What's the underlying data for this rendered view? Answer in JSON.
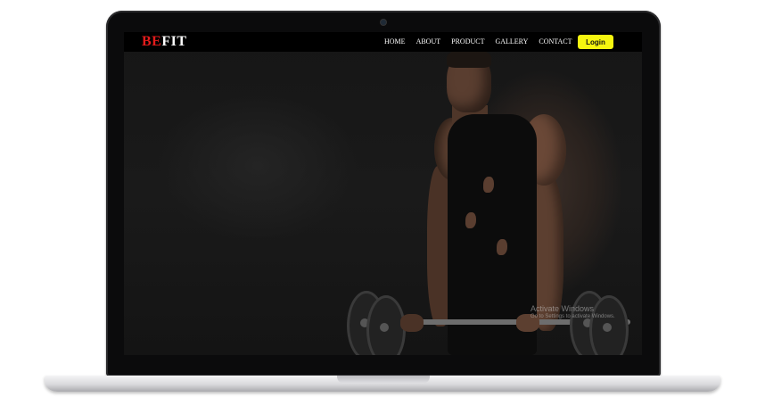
{
  "brand": {
    "part1": "BE",
    "part2": "FIT",
    "color_part1": "#e31b1b",
    "color_part2": "#ffffff"
  },
  "nav": {
    "links": [
      {
        "label": "HOME"
      },
      {
        "label": "ABOUT"
      },
      {
        "label": "PRODUCT"
      },
      {
        "label": "GALLERY"
      },
      {
        "label": "CONTACT"
      }
    ],
    "login_label": "Login",
    "login_color": "#f5f50f"
  },
  "watermark": {
    "title": "Activate Windows",
    "subtitle": "Go to Settings to activate Windows."
  },
  "colors": {
    "navbar_bg": "#000000",
    "hero_bg": "#121212"
  }
}
